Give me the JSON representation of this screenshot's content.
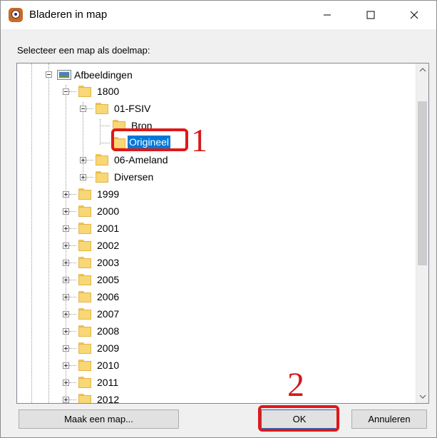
{
  "window": {
    "title": "Bladeren in map",
    "controls": {
      "minimize": "minimize-icon",
      "maximize": "maximize-icon",
      "close": "close-icon"
    }
  },
  "dialog": {
    "prompt": "Selecteer een map als doelmap:",
    "tree": {
      "items": [
        {
          "label": "Afbeeldingen",
          "icon": "picture-folder-icon",
          "expanded": true
        },
        {
          "label": "1800",
          "icon": "folder-icon",
          "expanded": true
        },
        {
          "label": "01-FSIV",
          "icon": "folder-icon",
          "expanded": true
        },
        {
          "label": "Bron",
          "icon": "folder-icon"
        },
        {
          "label": "Origineel",
          "icon": "folder-icon",
          "selected": true
        },
        {
          "label": "06-Ameland",
          "icon": "folder-icon",
          "expanded": false
        },
        {
          "label": "Diversen",
          "icon": "folder-icon",
          "expanded": false
        },
        {
          "label": "1999",
          "icon": "folder-icon",
          "expanded": false
        },
        {
          "label": "2000",
          "icon": "folder-icon",
          "expanded": false
        },
        {
          "label": "2001",
          "icon": "folder-icon",
          "expanded": false
        },
        {
          "label": "2002",
          "icon": "folder-icon",
          "expanded": false
        },
        {
          "label": "2003",
          "icon": "folder-icon",
          "expanded": false
        },
        {
          "label": "2005",
          "icon": "folder-icon",
          "expanded": false
        },
        {
          "label": "2006",
          "icon": "folder-icon",
          "expanded": false
        },
        {
          "label": "2007",
          "icon": "folder-icon",
          "expanded": false
        },
        {
          "label": "2008",
          "icon": "folder-icon",
          "expanded": false
        },
        {
          "label": "2009",
          "icon": "folder-icon",
          "expanded": false
        },
        {
          "label": "2010",
          "icon": "folder-icon",
          "expanded": false
        },
        {
          "label": "2011",
          "icon": "folder-icon",
          "expanded": false
        },
        {
          "label": "2012",
          "icon": "folder-icon",
          "expanded": false
        }
      ]
    },
    "buttons": {
      "new_folder": "Maak een map...",
      "ok": "OK",
      "cancel": "Annuleren"
    }
  },
  "annotations": {
    "step1": "1",
    "step2": "2",
    "color": "#e01818"
  },
  "colors": {
    "selection": "#0078d7",
    "folder": "#f8d775"
  }
}
